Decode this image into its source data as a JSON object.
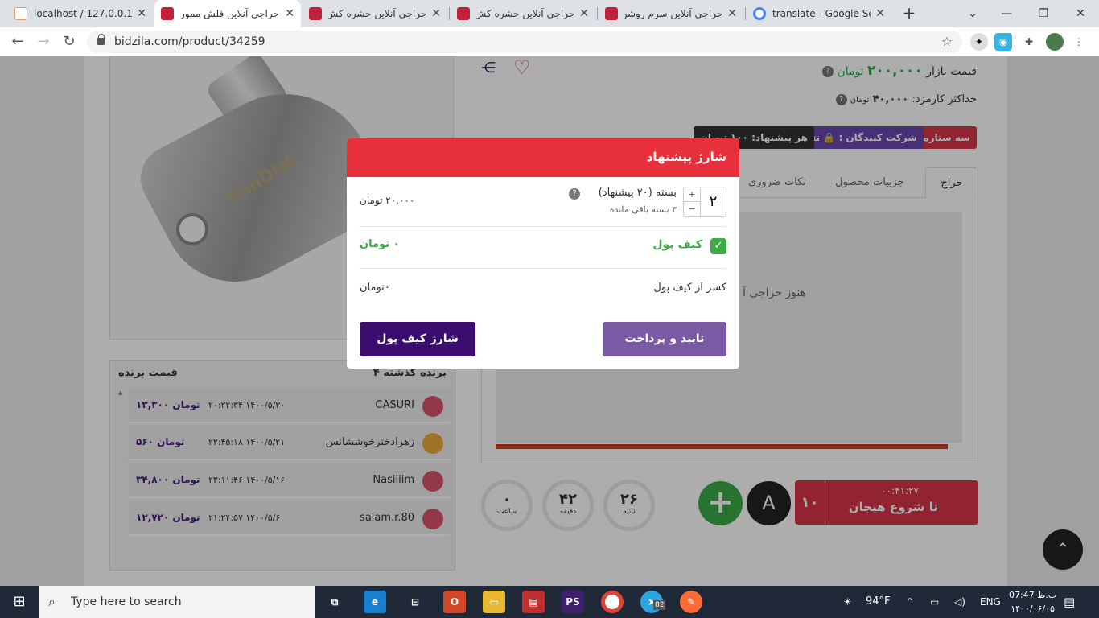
{
  "browser": {
    "tabs": [
      {
        "title": "localhost / 127.0.0.1 / ..."
      },
      {
        "title": "حراجی آنلاین فلش ممور"
      },
      {
        "title": "حراجی آنلاین حشره کش"
      },
      {
        "title": "حراجی آنلاین حشره کش"
      },
      {
        "title": "حراجی آنلاین سرم روشن"
      },
      {
        "title": "translate - Google Sea"
      }
    ],
    "url": "bidzila.com/product/34259"
  },
  "product": {
    "brand_text": "SanDisk",
    "market_price_label": "قیمت بازار",
    "market_price": "۲۰۰,۰۰۰",
    "market_price_unit": "تومان",
    "max_commission_label": "حداکثر کارمزد:",
    "max_commission": "۴۰,۰۰۰",
    "max_commission_unit": "تومان",
    "badges": [
      "سه ستاره",
      "شرکت کنندگان : 🔒 نفر",
      "هر پیشنهاد: ۱۰۰ تومان"
    ],
    "tabs": [
      "حراج",
      "جزییات محصول",
      "نکات ضروری"
    ],
    "empty_hint": "هنوز حراجی آ"
  },
  "winners": {
    "title": "۴ برنده گذشته",
    "price_header": "قیمت برنده",
    "rows": [
      {
        "name": "CASURI",
        "date": "۲۰:۲۲:۳۴ ۱۴۰۰/۵/۳۰",
        "price": "۱۳,۳۰۰ تومان"
      },
      {
        "name": "زهرادخترخوششانس",
        "date": "۲۲:۴۵:۱۸ ۱۴۰۰/۵/۲۱",
        "price": "۵۶۰ تومان"
      },
      {
        "name": "Nasiiiim",
        "date": "۲۳:۱۱:۴۶ ۱۴۰۰/۵/۱۶",
        "price": "۳۴,۸۰۰ تومان"
      },
      {
        "name": "salam.r.80",
        "date": "۲۱:۲۴:۵۷ ۱۴۰۰/۵/۶",
        "price": "۱۲,۷۲۰ تومان"
      }
    ]
  },
  "countdown": {
    "seconds": "۲۶",
    "seconds_label": "ثانیه",
    "minutes": "۴۲",
    "minutes_label": "دقیقه",
    "hours": "۰",
    "hours_label": "ساعت",
    "timer": "۰۰:۴۱:۲۷",
    "start_label": "تا شروع هیجان",
    "count": "۱۰",
    "a_label": "A"
  },
  "modal": {
    "title": "شارژ پیشنهاد",
    "qty": "۲",
    "pack_label": "بسته   (۲۰ پیشنهاد)",
    "remaining": "۳ بسته باقی مانده",
    "pack_price": "۲۰,۰۰۰  تومان",
    "wallet_label": "کیف پول",
    "wallet_value": "۰ تومان",
    "deduct_label": "کسر از کیف پول",
    "deduct_value": "۰تومان",
    "confirm_button": "تایید و پرداخت",
    "charge_button": "شارژ کیف پول"
  },
  "taskbar": {
    "search_placeholder": "Type here to search",
    "weather": "94°F",
    "lang": "ENG",
    "time": "07:47 ب.ظ",
    "date": "۱۴۰۰/۰۶/۰۵",
    "notif_count": "1",
    "telegram_badge": "82"
  },
  "colors": {
    "accent_red": "#e8303d",
    "purple": "#3a0d6e",
    "green": "#3caa47"
  }
}
